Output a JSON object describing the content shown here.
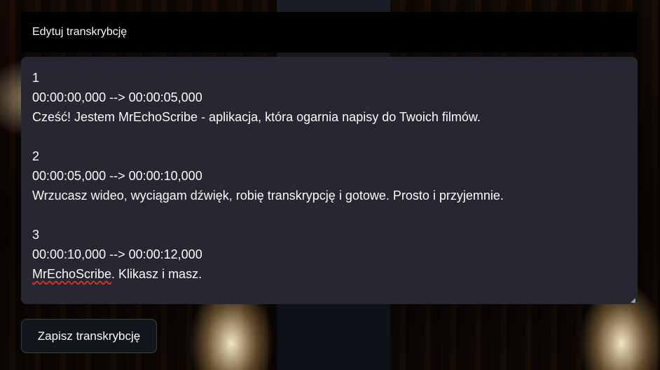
{
  "editor_section": {
    "title": "Edytuj transkrybcję"
  },
  "transcript": {
    "entries": [
      {
        "index": "1",
        "timecode": "00:00:00,000 --> 00:00:05,000",
        "text": "Cześć! Jestem MrEchoScribe - aplikacja, która ogarnia napisy do Twoich filmów."
      },
      {
        "index": "2",
        "timecode": "00:00:05,000 --> 00:00:10,000",
        "text": "Wrzucasz wideo, wyciągam dźwięk, robię transkrypcję i gotowe. Prosto i przyjemnie."
      },
      {
        "index": "3",
        "timecode": "00:00:10,000 --> 00:00:12,000",
        "text_misspelled_word": "MrEchoScribe",
        "text_rest": ". Klikasz i masz."
      }
    ]
  },
  "actions": {
    "save_label": "Zapisz transkrybcję"
  },
  "colors": {
    "header_bg": "#000000",
    "editor_bg": "#262730",
    "button_bg": "#13151d",
    "text": "#fafafa",
    "spellcheck_underline": "#e03030"
  }
}
